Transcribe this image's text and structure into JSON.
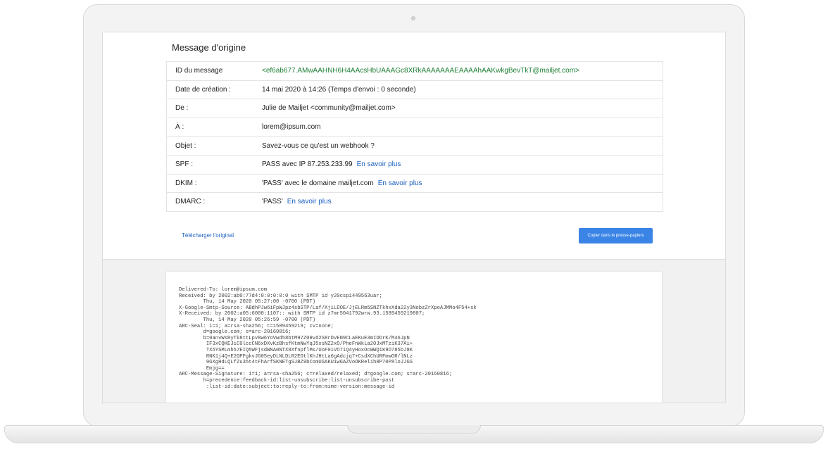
{
  "page_title": "Message d'origine",
  "rows": [
    {
      "key": "ID du message",
      "value": "<ef6ab677.AMwAAHNH6H4AAcsHbUAAAGc8XRkAAAAAAAEAAAAhAAKwkgBevTkT@mailjet.com>",
      "link": ""
    },
    {
      "key": "Date de création :",
      "value": "14 mai 2020 à 14:26 (Temps d'envoi : 0 seconde)",
      "link": ""
    },
    {
      "key": "De :",
      "value": "Julie de Mailjet <community@mailjet.com>",
      "link": ""
    },
    {
      "key": "À :",
      "value": "lorem@ipsum.com",
      "link": ""
    },
    {
      "key": "Objet :",
      "value": "Savez-vous ce qu'est un webhook ?",
      "link": ""
    },
    {
      "key": "SPF :",
      "value": "PASS avec IP 87.253.233.99",
      "link": "En savoir plus"
    },
    {
      "key": "DKIM :",
      "value": "'PASS' avec le domaine mailjet.com",
      "link": "En savoir plus"
    },
    {
      "key": "DMARC :",
      "value": "'PASS'",
      "link": "En savoir plus"
    }
  ],
  "download_label": "Télécharger l'original",
  "copy_label": "Copier dans le presse-papiers",
  "raw_lines": [
    "Delivered-To: lorem@ipsum.com",
    "Received: by 2002:ab0:77d4:0:0:0:0:0 with SMTP id y20csp1449563uar;",
    "        Thu, 14 May 2020 05:27:00 -0700 (PDT)",
    "X-Google-Smtp-Source: ABdhPJw6iFpWJpz4sbSTP/Laf/KjiLDOE/JjELRm5SNZTkhxXda22y3NobzZrXpoAJMMo4F54+sk",
    "X-Received: by 2002:a05:6000:1107:: with SMTP id z7mr5041792wrw.93.1589459219807;",
    "        Thu, 14 May 2020 05:26:59 -0700 (PDT)",
    "ARC-Seal: i=1; a=rsa-sha256; t=1589459219; cv=none;",
    "        d=google.com; s=arc-20160816;",
    "        b=0anvWsRyTk8ttLpv8w6YoVwd58btM97Z0Rvd2S8rDvEN9CLaEKuE3mIDDrK/M46JpN",
    "         IF3xCQKEJiC0lccCN6xDXvKzBhsfKtmNwYqJ5xsNZ2xO/PheFnWkLa20JxMTziK37Ai+",
    "         TX5YSMLmh57EIQ5WFjsdWNA0NTX8XfnpflMs/UoF0iVO7iQ4yHoxOcWWQiK9D785bJ8K",
    "         RNK1j4Q+E2GPFgkvJG05eyDLNLDLR2EOtlKhJHtLa6gAdcjq7+CsdXChURFmwOR/lNLz",
    "         9GXgHdLQLfZu35t4tFhArfSKNETgSJBZ9bComUGAKUiwGAZVoOKRelihRP70P8loJJGS",
    "         Emjg==",
    "ARC-Message-Signature: i=1; a=rsa-sha256; c=relaxed/relaxed; d=google.com; s=arc-20160816;",
    "        h=precedence:feedback-id:list-unsubscribe:list-unsubscribe-post",
    "         :list-id:date:subject:to:reply-to:from:mime-version:message-id"
  ]
}
